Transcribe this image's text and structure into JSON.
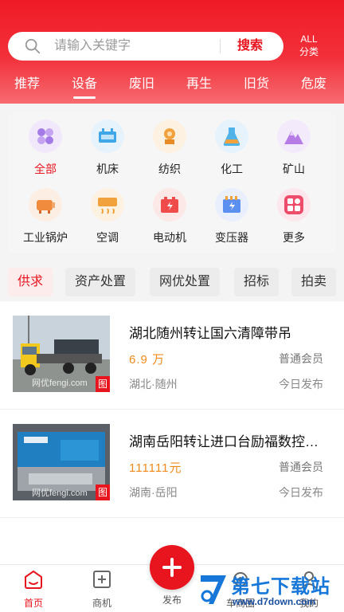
{
  "search": {
    "placeholder": "请输入关键字",
    "button_label": "搜索"
  },
  "all_button": {
    "line1": "ALL",
    "line2": "分类"
  },
  "tabs": [
    {
      "label": "推荐"
    },
    {
      "label": "设备"
    },
    {
      "label": "废旧"
    },
    {
      "label": "再生"
    },
    {
      "label": "旧货"
    },
    {
      "label": "危废"
    }
  ],
  "active_tab": "设备",
  "categories": [
    {
      "label": "全部",
      "icon": "grid-icon",
      "color": "#a47be6"
    },
    {
      "label": "机床",
      "icon": "machine-tool-icon",
      "color": "#3fa6e8"
    },
    {
      "label": "纺织",
      "icon": "textile-icon",
      "color": "#f2a23c"
    },
    {
      "label": "化工",
      "icon": "flask-icon",
      "color": "#4fb3e8"
    },
    {
      "label": "矿山",
      "icon": "mountain-icon",
      "color": "#b57ce6"
    },
    {
      "label": "工业锅炉",
      "icon": "boiler-icon",
      "color": "#f08a3c"
    },
    {
      "label": "空调",
      "icon": "air-conditioner-icon",
      "color": "#f2a23c"
    },
    {
      "label": "电动机",
      "icon": "battery-icon",
      "color": "#ef4b4b"
    },
    {
      "label": "变压器",
      "icon": "transformer-icon",
      "color": "#5b8ff0"
    },
    {
      "label": "更多",
      "icon": "more-icon",
      "color": "#ef4b6a"
    }
  ],
  "filters": [
    {
      "label": "供求"
    },
    {
      "label": "资产处置"
    },
    {
      "label": "网优处置"
    },
    {
      "label": "招标"
    },
    {
      "label": "拍卖"
    }
  ],
  "listings": [
    {
      "title": "湖北随州转让国六清障带吊",
      "price": "6.9 万",
      "member": "普通会员",
      "location": "湖北·随州",
      "time": "今日发布",
      "tag": "图",
      "image_watermark": "网优fengi.com"
    },
    {
      "title": "湖南岳阳转让进口台励福数控…",
      "price": "111111元",
      "member": "普通会员",
      "location": "湖南·岳阳",
      "time": "今日发布",
      "tag": "图",
      "image_watermark": "网优fengi.com"
    }
  ],
  "bottom_nav": {
    "home": "首页",
    "business": "商机",
    "publish": "发布",
    "car": "车商圈",
    "mine": "我的"
  },
  "watermark": {
    "title": "第七下载站",
    "url": "www.d7down.com"
  },
  "colors": {
    "brand_red": "#e8141e",
    "price_orange": "#f08a1c",
    "watermark_blue": "#1677d9"
  }
}
